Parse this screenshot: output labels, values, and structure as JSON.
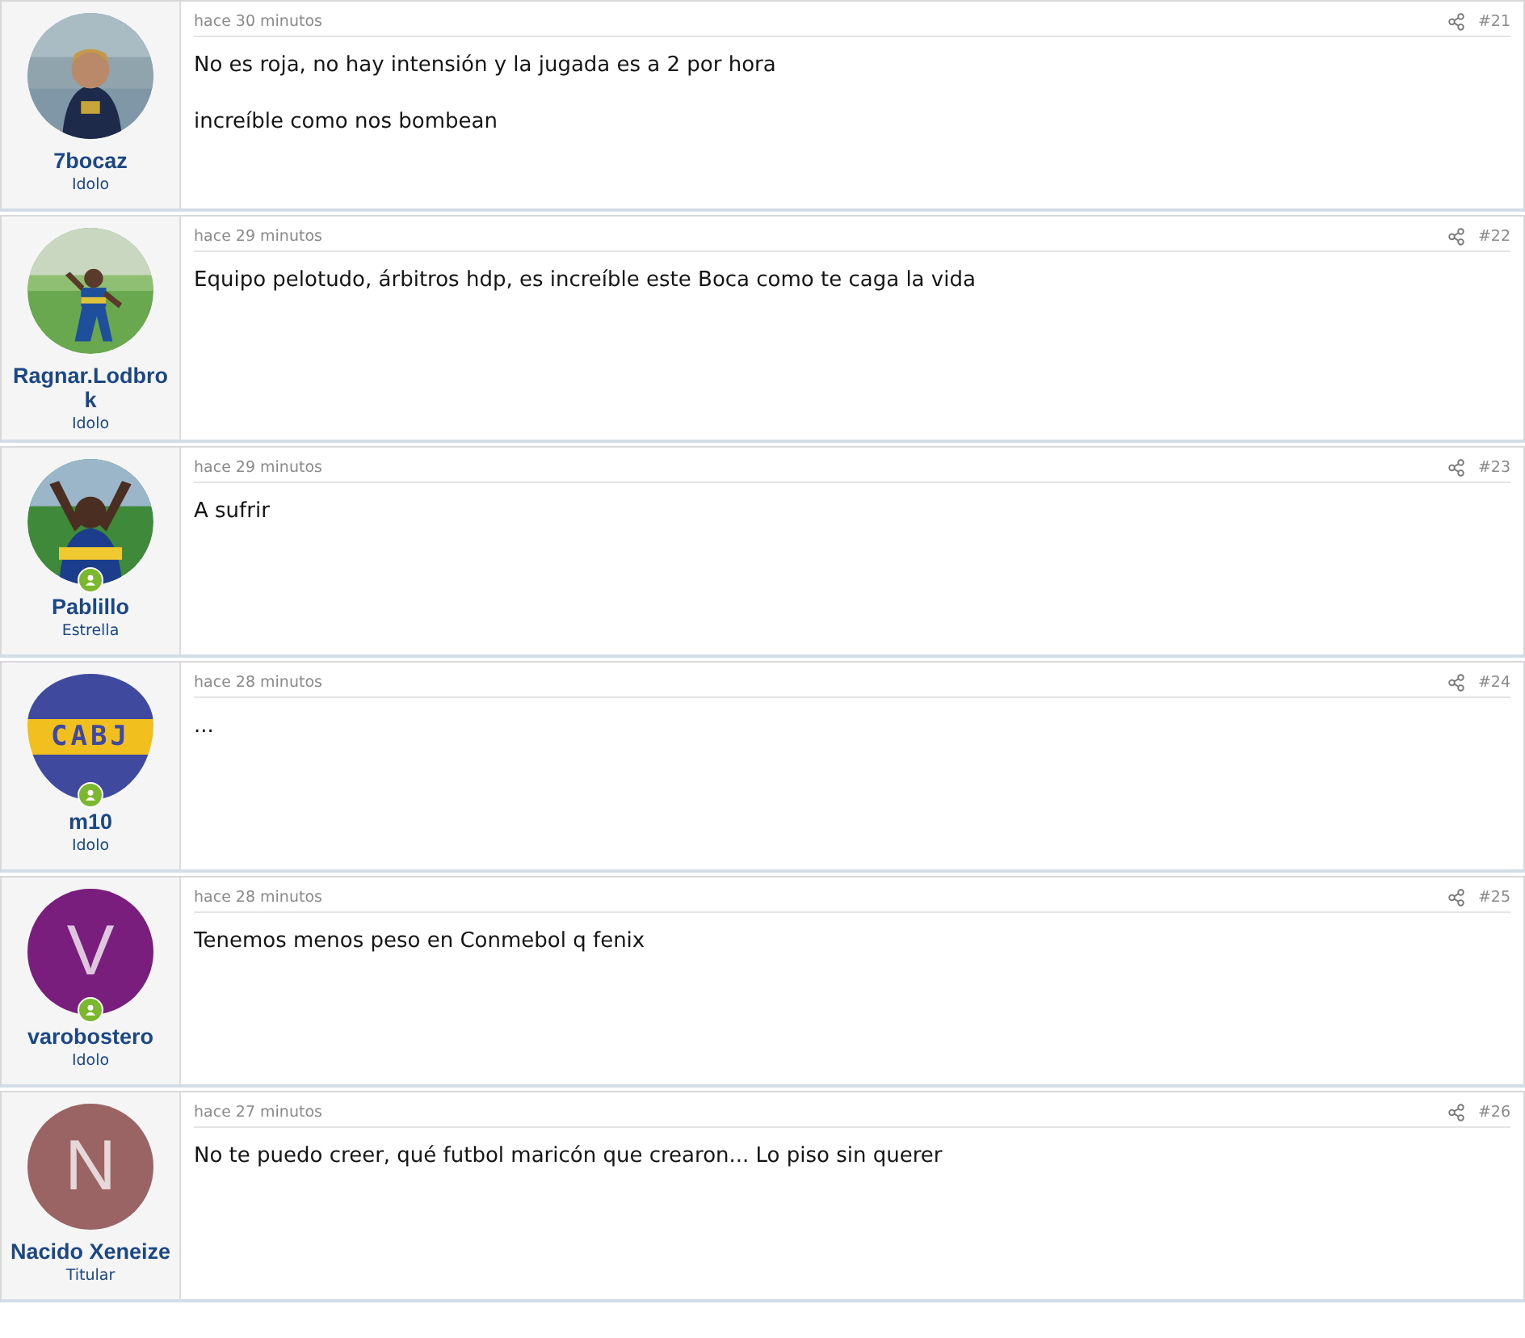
{
  "posts": [
    {
      "author": "7bocaz",
      "role": "Idolo",
      "avatar": {
        "kind": "picture"
      },
      "online": false,
      "time": "hace 30 minutos",
      "number": "#21",
      "paragraphs": [
        "No es roja, no hay intensión y la jugada es a 2 por hora",
        "increíble como nos bombean"
      ]
    },
    {
      "author": "Ragnar.Lodbrok",
      "role": "Idolo",
      "avatar": {
        "kind": "picture"
      },
      "online": false,
      "time": "hace 29 minutos",
      "number": "#22",
      "paragraphs": [
        "Equipo pelotudo, árbitros hdp, es increíble este Boca como te caga la vida"
      ]
    },
    {
      "author": "Pablillo",
      "role": "Estrella",
      "avatar": {
        "kind": "picture"
      },
      "online": true,
      "time": "hace 29 minutos",
      "number": "#23",
      "paragraphs": [
        "A sufrir"
      ]
    },
    {
      "author": "m10",
      "role": "Idolo",
      "avatar": {
        "kind": "logo",
        "text": "CABJ"
      },
      "online": true,
      "time": "hace 28 minutos",
      "number": "#24",
      "paragraphs": [
        "..."
      ]
    },
    {
      "author": "varobostero",
      "role": "Idolo",
      "avatar": {
        "kind": "letter",
        "text": "V",
        "color": "#7a1e7e"
      },
      "online": true,
      "time": "hace 28 minutos",
      "number": "#25",
      "paragraphs": [
        "Tenemos menos peso en Conmebol q fenix"
      ]
    },
    {
      "author": "Nacido Xeneize",
      "role": "Titular",
      "avatar": {
        "kind": "letter",
        "text": "N",
        "color": "#9a6464"
      },
      "online": false,
      "time": "hace 27 minutos",
      "number": "#26",
      "paragraphs": [
        "No te puedo creer, qué futbol maricón que crearon... Lo piso sin querer"
      ]
    }
  ]
}
